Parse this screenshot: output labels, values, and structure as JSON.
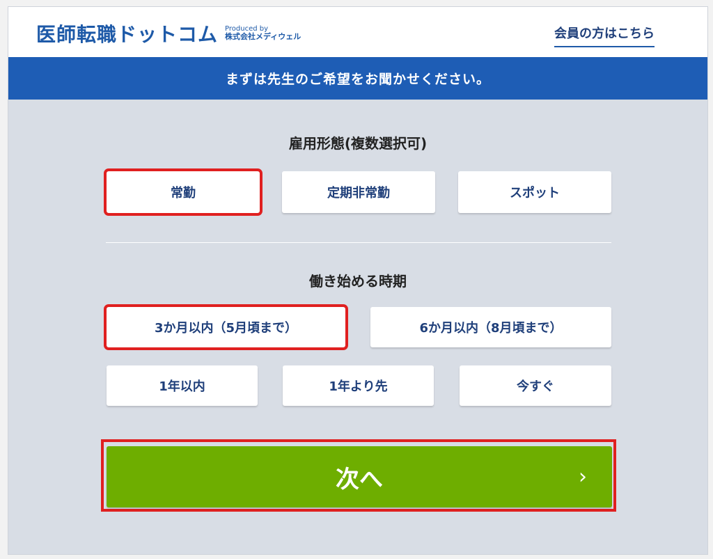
{
  "header": {
    "logo_main": "医師転職ドットコム",
    "logo_produced": "Produced by",
    "logo_company": "株式会社メディウェル",
    "member_link": "会員の方はこちら"
  },
  "banner": {
    "text": "まずは先生のご希望をお聞かせください。"
  },
  "employment": {
    "title": "雇用形態(複数選択可)",
    "options": [
      "常勤",
      "定期非常勤",
      "スポット"
    ],
    "selected": "常勤"
  },
  "start_timing": {
    "title": "働き始める時期",
    "options": [
      "3か月以内（5月頃まで）",
      "6か月以内（8月頃まで）",
      "1年以内",
      "1年より先",
      "今すぐ"
    ],
    "selected": "3か月以内（5月頃まで）"
  },
  "next_button": {
    "label": "次へ",
    "chevron": "›"
  },
  "colors": {
    "brand_blue": "#1e5db5",
    "next_green": "#6eae00",
    "highlight_red": "#e02020"
  }
}
